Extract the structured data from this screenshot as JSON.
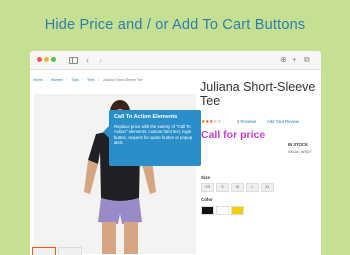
{
  "headline": "Hide Price and / or Add To Cart Buttons",
  "browser": {
    "nav_back": "‹",
    "nav_forward": "›",
    "right_icons": [
      "⊕",
      "+",
      "⧉"
    ]
  },
  "breadcrumbs": [
    "Home",
    "Women",
    "Tops",
    "Tees",
    "Juliana Short-Sleeve Tee"
  ],
  "tooltip": {
    "title": "Call To Action Elements",
    "body": "Replace price with the variety of \"Call To Action\" elements: custom html text, login button, request for quote button or popup alert."
  },
  "product": {
    "title": "Juliana Short-Sleeve Tee",
    "rating_filled": 3,
    "rating_total": 5,
    "reviews_label": "2 Reviews",
    "add_review_label": "Add Your Review",
    "call_for_price": "Call for price",
    "stock_status": "IN STOCK",
    "sku": "SKU#: WS07",
    "size_label": "Size",
    "sizes": [
      "XS",
      "S",
      "M",
      "L",
      "XL"
    ],
    "color_label": "Color",
    "colors": [
      "#111111",
      "#ffffff",
      "#f0d000"
    ]
  },
  "colors": {
    "background": "#c5e093",
    "headline": "#2e7ea8",
    "tooltip": "#2a8fc9",
    "call_price": "#c53fd2",
    "stars": "#ff5501"
  }
}
